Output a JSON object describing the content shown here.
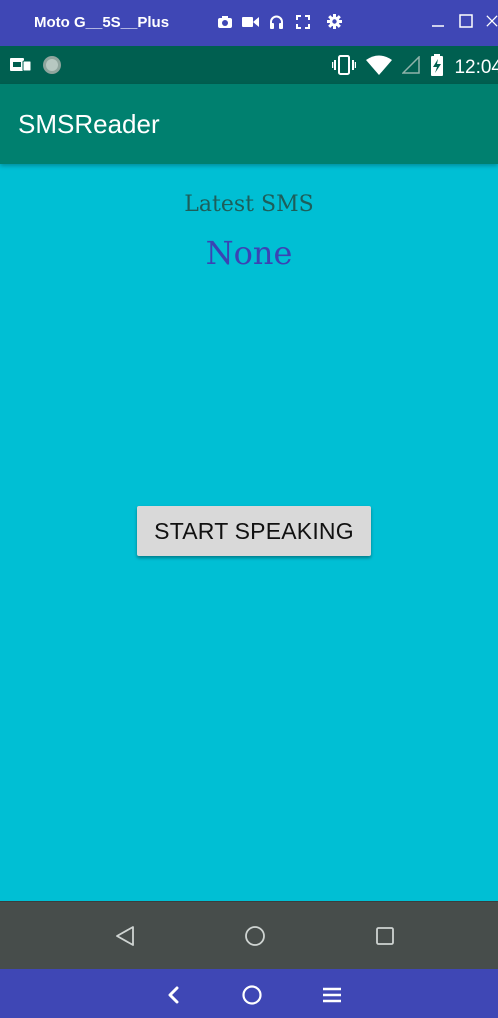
{
  "emulator": {
    "device_title": "Moto G__5S__Plus",
    "toolbar_icons": [
      "camera-icon",
      "video-icon",
      "headphones-icon",
      "fullscreen-icon",
      "settings-icon"
    ],
    "window_controls": [
      "minimize-icon",
      "maximize-icon",
      "close-icon"
    ],
    "bottom_controls": [
      "back-chevron-icon",
      "home-circle-icon",
      "menu-icon"
    ]
  },
  "status_bar": {
    "left_icons": [
      "notification-app-icon",
      "sync-circle-icon"
    ],
    "right_icons": [
      "vibrate-icon",
      "wifi-icon",
      "signal-icon",
      "battery-charging-icon"
    ],
    "time": "12:04"
  },
  "app_bar": {
    "title": "SMSReader"
  },
  "main": {
    "latest_label": "Latest SMS",
    "latest_value": "None",
    "speak_button": "START SPEAKING"
  },
  "nav_bar": {
    "buttons": [
      "back-triangle-icon",
      "home-icon",
      "recents-icon"
    ]
  },
  "colors": {
    "emulator_bar": "#3f47b5",
    "status_bar": "#005f50",
    "app_bar": "#00806f",
    "content_bg": "#00bfd4",
    "label_text": "#1d5e5a",
    "value_text": "#3a44b4",
    "button_bg": "#d9d9d9",
    "nav_bar": "#474d4b"
  }
}
